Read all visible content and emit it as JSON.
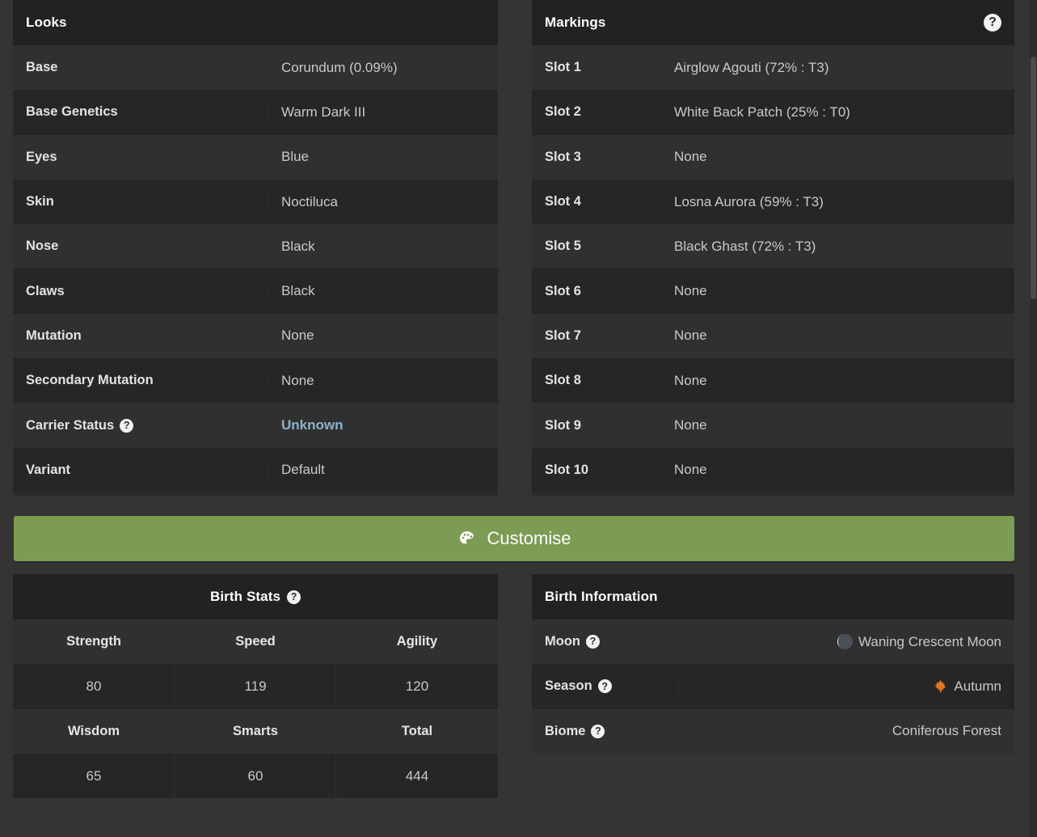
{
  "looks": {
    "title": "Looks",
    "rows": [
      {
        "label": "Base",
        "value": "Corundum (0.09%)",
        "help": false,
        "link": false
      },
      {
        "label": "Base Genetics",
        "value": "Warm Dark III",
        "help": false,
        "link": false
      },
      {
        "label": "Eyes",
        "value": "Blue",
        "help": false,
        "link": false
      },
      {
        "label": "Skin",
        "value": "Noctiluca",
        "help": false,
        "link": false
      },
      {
        "label": "Nose",
        "value": "Black",
        "help": false,
        "link": false
      },
      {
        "label": "Claws",
        "value": "Black",
        "help": false,
        "link": false
      },
      {
        "label": "Mutation",
        "value": "None",
        "help": false,
        "link": false
      },
      {
        "label": "Secondary Mutation",
        "value": "None",
        "help": false,
        "link": false
      },
      {
        "label": "Carrier Status",
        "value": "Unknown",
        "help": true,
        "link": true
      },
      {
        "label": "Variant",
        "value": "Default",
        "help": false,
        "link": false
      }
    ]
  },
  "markings": {
    "title": "Markings",
    "help_icon": "help-circle-icon",
    "rows": [
      {
        "label": "Slot 1",
        "value": "Airglow Agouti (72% : T3)"
      },
      {
        "label": "Slot 2",
        "value": "White Back Patch (25% : T0)"
      },
      {
        "label": "Slot 3",
        "value": "None"
      },
      {
        "label": "Slot 4",
        "value": "Losna Aurora (59% : T3)"
      },
      {
        "label": "Slot 5",
        "value": "Black Ghast (72% : T3)"
      },
      {
        "label": "Slot 6",
        "value": "None"
      },
      {
        "label": "Slot 7",
        "value": "None"
      },
      {
        "label": "Slot 8",
        "value": "None"
      },
      {
        "label": "Slot 9",
        "value": "None"
      },
      {
        "label": "Slot 10",
        "value": "None"
      }
    ]
  },
  "customise": {
    "label": "Customise",
    "icon": "palette-icon",
    "color": "#7c9c54"
  },
  "birth_stats": {
    "title": "Birth Stats",
    "help_icon": "help-circle-icon",
    "rows": [
      {
        "type": "header",
        "cells": [
          "Strength",
          "Speed",
          "Agility"
        ]
      },
      {
        "type": "values",
        "cells": [
          "80",
          "119",
          "120"
        ]
      },
      {
        "type": "header",
        "cells": [
          "Wisdom",
          "Smarts",
          "Total"
        ]
      },
      {
        "type": "values",
        "cells": [
          "65",
          "60",
          "444"
        ]
      }
    ]
  },
  "birth_information": {
    "title": "Birth Information",
    "rows": [
      {
        "label": "Moon",
        "value": "Waning Crescent Moon",
        "help": true,
        "icon": "waning-crescent-moon-icon"
      },
      {
        "label": "Season",
        "value": "Autumn",
        "help": true,
        "icon": "maple-leaf-icon"
      },
      {
        "label": "Biome",
        "value": "Coniferous Forest",
        "help": true,
        "icon": ""
      }
    ]
  },
  "theme": {
    "background": "#343434",
    "panel_bg": "#2b2b2b",
    "panel_head_bg": "#222222",
    "row_odd": "#303030",
    "row_even": "#262626",
    "link_color": "#8fb2cc",
    "accent_green": "#7c9c54"
  }
}
